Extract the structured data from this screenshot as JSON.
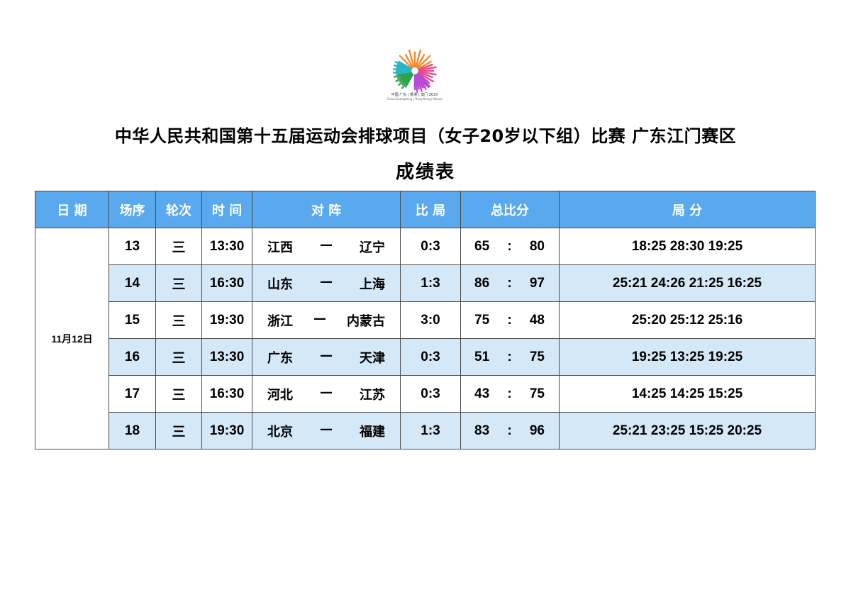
{
  "logo": {
    "name": "games-flower-logo",
    "caption_line1": "中国·广东 | 香港 | 澳门 2025",
    "caption_line2": "China·Guangdong | Hong Kong | Macao",
    "colors": [
      "#f28a2e",
      "#e84a8a",
      "#b84ad8",
      "#2ea34a",
      "#2bb5c4",
      "#f5c23a"
    ]
  },
  "title": "中华人民共和国第十五届运动会排球项目（女子20岁以下组）比赛  广东江门赛区",
  "subtitle": "成绩表",
  "headers": {
    "date": "日 期",
    "seq": "场序",
    "round": "轮次",
    "time": "时 间",
    "match": "对 阵",
    "sets": "比 局",
    "total": "总比分",
    "scores": "局 分"
  },
  "date": "11月12日",
  "rows": [
    {
      "seq": "13",
      "round": "三",
      "time": "13:30",
      "home": "江西",
      "dash": "—",
      "away": "辽宁",
      "sets": "0:3",
      "pts_home": "65",
      "colon": ":",
      "pts_away": "80",
      "scores": "18:25 28:30 19:25"
    },
    {
      "seq": "14",
      "round": "三",
      "time": "16:30",
      "home": "山东",
      "dash": "—",
      "away": "上海",
      "sets": "1:3",
      "pts_home": "86",
      "colon": ":",
      "pts_away": "97",
      "scores": "25:21 24:26 21:25 16:25"
    },
    {
      "seq": "15",
      "round": "三",
      "time": "19:30",
      "home": "浙江",
      "dash": "—",
      "away": "内蒙古",
      "sets": "3:0",
      "pts_home": "75",
      "colon": ":",
      "pts_away": "48",
      "scores": "25:20 25:12 25:16"
    },
    {
      "seq": "16",
      "round": "三",
      "time": "13:30",
      "home": "广东",
      "dash": "—",
      "away": "天津",
      "sets": "0:3",
      "pts_home": "51",
      "colon": ":",
      "pts_away": "75",
      "scores": "19:25 13:25 19:25"
    },
    {
      "seq": "17",
      "round": "三",
      "time": "16:30",
      "home": "河北",
      "dash": "—",
      "away": "江苏",
      "sets": "0:3",
      "pts_home": "43",
      "colon": ":",
      "pts_away": "75",
      "scores": "14:25 14:25 15:25"
    },
    {
      "seq": "18",
      "round": "三",
      "time": "19:30",
      "home": "北京",
      "dash": "—",
      "away": "福建",
      "sets": "1:3",
      "pts_home": "83",
      "colon": ":",
      "pts_away": "96",
      "scores": "25:21 23:25 15:25 20:25"
    }
  ],
  "colors": {
    "header_bg": "#5aa9ee",
    "row_shade": "#d4e8f8"
  }
}
